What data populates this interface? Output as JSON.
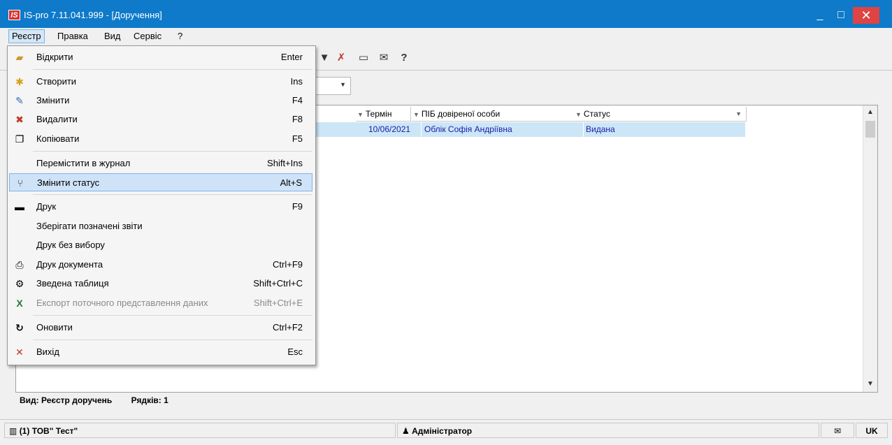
{
  "titlebar": {
    "logo": "IS",
    "title": "IS-pro 7.11.041.999 - [Доручення]",
    "minimize": "_",
    "maximize": "□",
    "close": "✕"
  },
  "menubar": [
    "Реєстр",
    "Правка",
    "Вид",
    "Сервіс",
    "?"
  ],
  "dropdown": {
    "items": [
      {
        "label": "Відкрити",
        "shortcut": "Enter",
        "icon": "open-folder-icon",
        "glyph": "📂"
      },
      {
        "label": "Створити",
        "shortcut": "Ins",
        "icon": "new-document-icon",
        "glyph": "✱"
      },
      {
        "label": "Змінити",
        "shortcut": "F4",
        "icon": "edit-document-icon",
        "glyph": "✎"
      },
      {
        "label": "Видалити",
        "shortcut": "F8",
        "icon": "delete-document-icon",
        "glyph": "✖"
      },
      {
        "label": "Копіювати",
        "shortcut": "F5",
        "icon": "copy-icon",
        "glyph": "❐"
      },
      {
        "label": "Перемістити в журнал",
        "shortcut": "Shift+Ins",
        "icon": "",
        "glyph": ""
      },
      {
        "label": "Змінити статус",
        "shortcut": "Alt+S",
        "icon": "change-status-icon",
        "glyph": "⑂"
      },
      {
        "label": "Друк",
        "shortcut": "F9",
        "icon": "printer-icon",
        "glyph": "🖶"
      },
      {
        "label": "Зберігати позначені звіти",
        "shortcut": "",
        "icon": "",
        "glyph": ""
      },
      {
        "label": "Друк без вибору",
        "shortcut": "",
        "icon": "",
        "glyph": ""
      },
      {
        "label": "Друк документа",
        "shortcut": "Ctrl+F9",
        "icon": "print-document-icon",
        "glyph": "⎙"
      },
      {
        "label": "Зведена таблиця",
        "shortcut": "Shift+Ctrl+C",
        "icon": "pivot-table-icon",
        "glyph": "⚙"
      },
      {
        "label": "Експорт поточного представлення даних",
        "shortcut": "Shift+Ctrl+E",
        "icon": "excel-export-icon",
        "glyph": "X"
      },
      {
        "label": "Оновити",
        "shortcut": "Ctrl+F2",
        "icon": "refresh-icon",
        "glyph": "↻"
      },
      {
        "label": "Вихід",
        "shortcut": "Esc",
        "icon": "exit-icon",
        "glyph": "✕"
      }
    ]
  },
  "grid": {
    "columns": [
      "Термін",
      "ПІБ довіреної особи",
      "Статус"
    ],
    "rows": [
      {
        "term": "10/06/2021",
        "person": "Облік Софія Андріївна",
        "status": "Видана"
      }
    ]
  },
  "footer": {
    "view": "Вид: Реєстр доручень",
    "rows_count": "Рядків: 1"
  },
  "statusbar": {
    "company": "(1) ТОВ\" Тест\"",
    "user": "Адміністратор",
    "lang": "UK"
  },
  "colors": {
    "titlebar": "#0e7ac9",
    "close": "#e04343",
    "selection": "#cde6f7",
    "highlight": "#cfe3f8"
  }
}
